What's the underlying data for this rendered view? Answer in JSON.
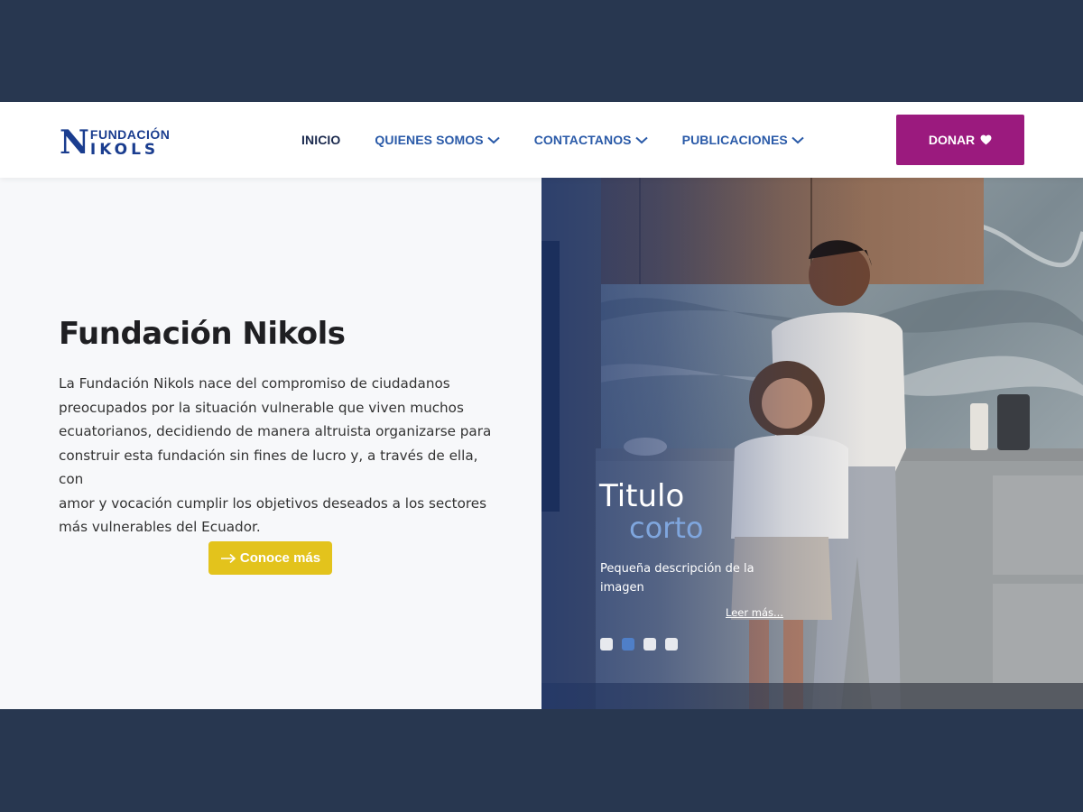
{
  "brand": {
    "logo_letter": "N",
    "logo_line1": "FUNDACIÓN",
    "logo_line2": "IKOLS"
  },
  "nav": {
    "items": [
      {
        "label": "INICIO",
        "dropdown": false,
        "active": true
      },
      {
        "label": "QUIENES SOMOS",
        "dropdown": true,
        "active": false
      },
      {
        "label": "CONTACTANOS",
        "dropdown": true,
        "active": false
      },
      {
        "label": "PUBLICACIONES",
        "dropdown": true,
        "active": false
      }
    ],
    "donate_label": "DONAR"
  },
  "hero": {
    "title": "Fundación Nikols",
    "paragraph_lines": [
      "La Fundación Nikols nace del compromiso de ciudadanos",
      "preocupados por la situación vulnerable que viven muchos",
      "ecuatorianos, decidiendo de manera altruista organizarse para",
      "construir esta fundación sin fines de lucro y, a través de ella, con",
      "amor y vocación cumplir los objetivos deseados a los sectores",
      "más vulnerables del Ecuador."
    ],
    "cta_label": "Conoce más"
  },
  "slider": {
    "title_line1": "Titulo",
    "title_line2": "corto",
    "description": "Pequeña descripción de la imagen",
    "link_label": "Leer más...",
    "dots_count": 4,
    "active_dot": 1
  },
  "colors": {
    "backdrop": "#283750",
    "brand_blue": "#1a3d8f",
    "donate": "#9b1a7e",
    "cta": "#e3c31c",
    "active_dot": "#4f7fc8"
  },
  "icons": {
    "nav_dropdown": "chevron-down-icon",
    "donate": "heart-icon",
    "cta": "arrow-right-icon"
  }
}
